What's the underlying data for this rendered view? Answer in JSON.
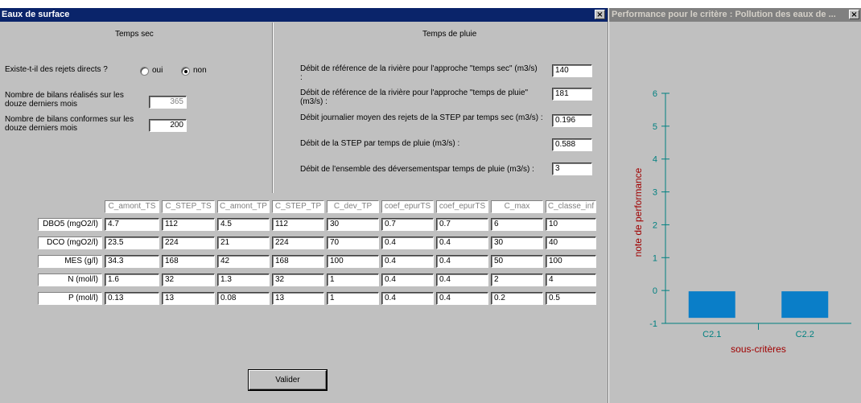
{
  "left_window": {
    "title": "Eaux de surface",
    "close_glyph": "×",
    "dry": {
      "header": "Temps sec",
      "direct_discharge_label": "Existe-t-il des rejets directs ?",
      "option_yes": "oui",
      "option_no": "non",
      "selected": "non",
      "reports_label": "Nombre de bilans réalisés sur les douze derniers mois",
      "reports_value": "365",
      "compliant_label": "Nombre de bilans conformes sur les douze derniers mois",
      "compliant_value": "200"
    },
    "wet": {
      "header": "Temps de pluie",
      "fields": [
        {
          "label": "Débit de référence de la rivière pour l'approche \"temps sec\" (m3/s) :",
          "value": "140"
        },
        {
          "label": "Débit de référence de la rivière pour l'approche \"temps de pluie\" (m3/s) :",
          "value": "181"
        },
        {
          "label": "Débit journalier moyen des rejets de la STEP par temps sec (m3/s) :",
          "value": "0.196"
        },
        {
          "label": "Débit de la STEP par temps de pluie (m3/s) :",
          "value": "0.588"
        },
        {
          "label": "Débit de l'ensemble des déversementspar temps de pluie (m3/s) :",
          "value": "3"
        }
      ]
    },
    "table": {
      "columns": [
        "C_amont_TS",
        "C_STEP_TS",
        "C_amont_TP",
        "C_STEP_TP",
        "C_dev_TP",
        "coef_epurTS",
        "coef_epurTS",
        "C_max",
        "C_classe_inf"
      ],
      "rows": [
        {
          "label": "DBO5 (mgO2/l)",
          "values": [
            "4.7",
            "112",
            "4.5",
            "112",
            "30",
            "0.7",
            "0.7",
            "6",
            "10"
          ]
        },
        {
          "label": "DCO (mgO2/l)",
          "values": [
            "23.5",
            "224",
            "21",
            "224",
            "70",
            "0.4",
            "0.4",
            "30",
            "40"
          ]
        },
        {
          "label": "MES (g/l)",
          "values": [
            "34.3",
            "168",
            "42",
            "168",
            "100",
            "0.4",
            "0.4",
            "50",
            "100"
          ]
        },
        {
          "label": "N (mol/l)",
          "values": [
            "1.6",
            "32",
            "1.3",
            "32",
            "1",
            "0.4",
            "0.4",
            "2",
            "4"
          ]
        },
        {
          "label": "P (mol/l)",
          "values": [
            "0.13",
            "13",
            "0.08",
            "13",
            "1",
            "0.4",
            "0.4",
            "0.2",
            "0.5"
          ]
        }
      ]
    },
    "validate_label": "Valider"
  },
  "right_window": {
    "title": "Performance pour le critère : Pollution des eaux de ...",
    "close_glyph": "×"
  },
  "colors": {
    "bar": "#0a7ec8",
    "axis": "#008080",
    "label_red": "#a00000",
    "title_active": "#0a246a",
    "title_inactive": "#808080"
  },
  "chart_data": {
    "type": "bar",
    "categories": [
      "C2.1",
      "C2.2"
    ],
    "values": [
      0,
      0
    ],
    "xlabel": "sous-critères",
    "ylabel": "note de performance",
    "ylim": [
      -1,
      6
    ],
    "yticks": [
      -1,
      0,
      1,
      2,
      3,
      4,
      5,
      6
    ],
    "grid": false,
    "legend": "none"
  }
}
